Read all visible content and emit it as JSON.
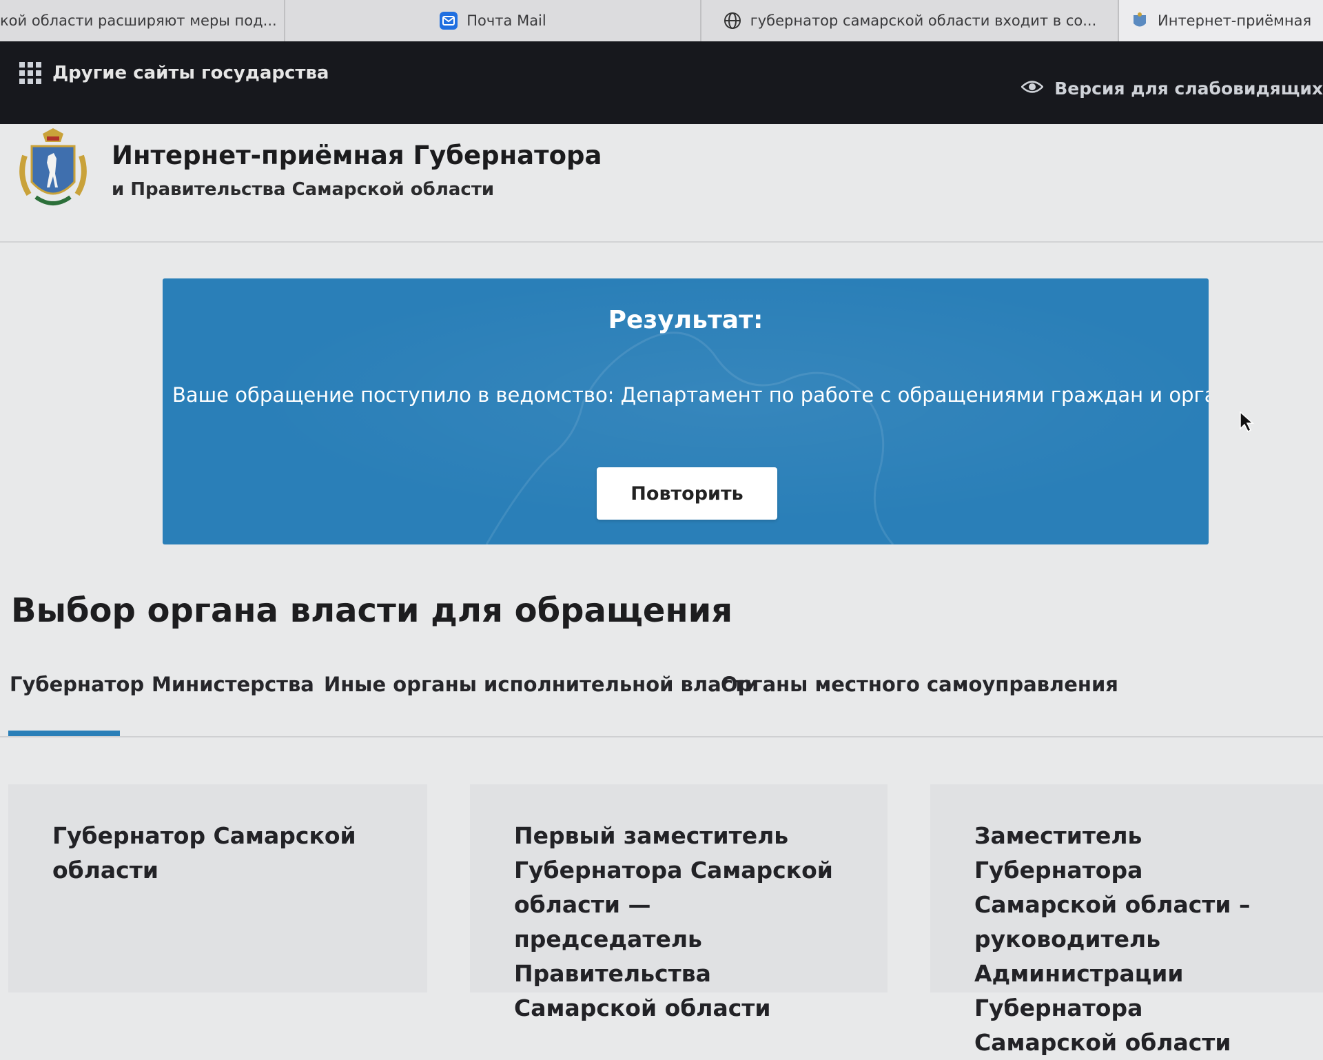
{
  "browser": {
    "tabs": [
      {
        "title": "кой области расширяют меры под...",
        "icon": "none"
      },
      {
        "title": "Почта Mail",
        "icon": "mail-icon"
      },
      {
        "title": "губернатор самарской области входит в со...",
        "icon": "globe-icon"
      },
      {
        "title": "Интернет-приёмная",
        "icon": "emblem-favicon-icon"
      }
    ]
  },
  "govbar": {
    "other_sites": "Другие сайты государства",
    "accessibility": "Версия для слабовидящих"
  },
  "header": {
    "title": "Интернет-приёмная Губернатора",
    "subtitle": "и Правительства Самарской области"
  },
  "result": {
    "title": "Результат:",
    "message": "Ваше обращение поступило в ведомство: Департамент по работе с обращениями граждан и организаций",
    "retry_label": "Повторить"
  },
  "section": {
    "title": "Выбор органа власти для обращения",
    "tabs": [
      {
        "label": "Губернатор",
        "active": true
      },
      {
        "label": "Министерства",
        "active": false
      },
      {
        "label": "Иные органы исполнительной власти",
        "active": false
      },
      {
        "label": "Органы местного самоуправления",
        "active": false
      }
    ],
    "cards": [
      {
        "label": "Губернатор Самарской области"
      },
      {
        "label": "Первый заместитель Губернатора Самарской области — председатель Правительства Самарской области"
      },
      {
        "label": "Заместитель Губернатора Самарской области – руководитель Администрации Губернатора Самарской области"
      }
    ]
  },
  "colors": {
    "accent": "#2a7fb8",
    "govbar": "#17181d",
    "page_bg": "#e8e9ea"
  }
}
